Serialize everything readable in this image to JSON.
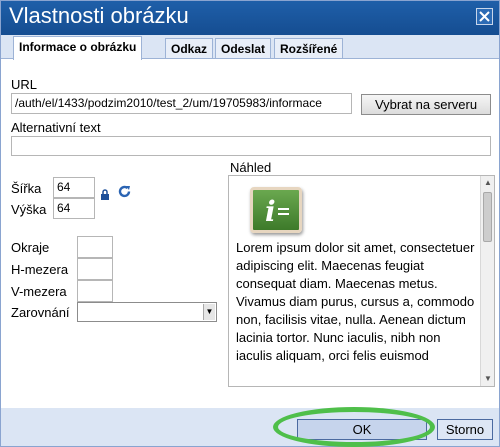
{
  "dialog": {
    "title": "Vlastnosti obrázku",
    "close_icon": "close-icon",
    "tabs": [
      {
        "label": "Informace o obrázku",
        "active": true
      },
      {
        "label": "Odkaz",
        "active": false
      },
      {
        "label": "Odeslat",
        "active": false
      },
      {
        "label": "Rozšířené",
        "active": false
      }
    ]
  },
  "info": {
    "url_label": "URL",
    "url_value": "/auth/el/1433/podzim2010/test_2/um/19705983/informace",
    "browse_label": "Vybrat na serveru",
    "alt_label": "Alternativní text",
    "alt_value": "",
    "width_label": "Šířka",
    "width_value": "64",
    "height_label": "Výška",
    "height_value": "64",
    "lock_icon": "lock-icon",
    "reset_icon": "refresh-icon",
    "border_label": "Okraje",
    "border_value": "",
    "hspace_label": "H-mezera",
    "hspace_value": "",
    "vspace_label": "V-mezera",
    "vspace_value": "",
    "align_label": "Zarovnání",
    "align_value": ""
  },
  "preview": {
    "label": "Náhled",
    "image_icon": "info-icon",
    "text": "Lorem ipsum dolor sit amet, consectetuer adipiscing elit. Maecenas feugiat consequat diam. Maecenas metus. Vivamus diam purus, cursus a, commodo non, facilisis vitae, nulla. Aenean dictum lacinia tortor. Nunc iaculis, nibh non iaculis aliquam, orci felis euismod"
  },
  "footer": {
    "ok_label": "OK",
    "cancel_label": "Storno"
  },
  "colors": {
    "titlebar": "#1f5fa9",
    "dialog_bg": "#dbe5f4",
    "highlight_ring": "#4fbf4a"
  }
}
